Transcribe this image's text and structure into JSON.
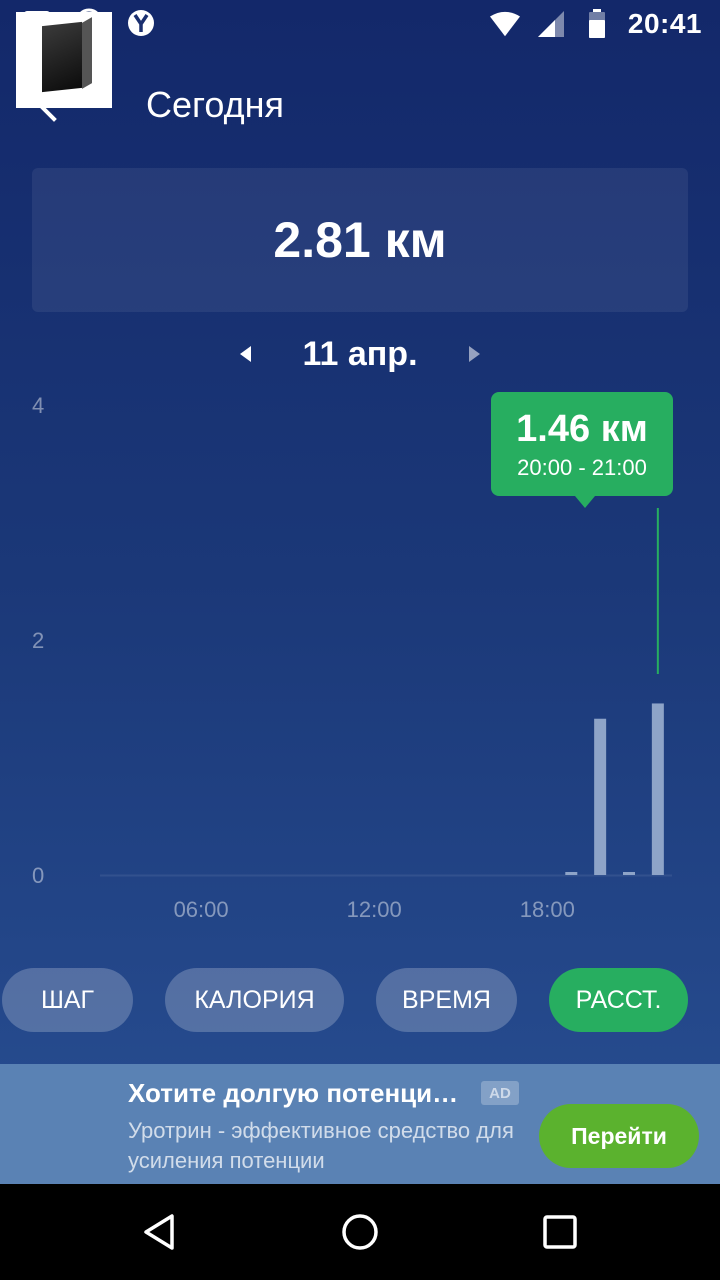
{
  "status_bar": {
    "time": "20:41",
    "left_icons": [
      "message-icon",
      "whatsapp-icon",
      "yandex-icon"
    ],
    "right_icons": [
      "wifi-icon",
      "signal-icon",
      "battery-icon"
    ]
  },
  "header": {
    "title": "Сегодня",
    "back_icon": "arrow-left-icon"
  },
  "summary": {
    "total": "2.81 км"
  },
  "date_nav": {
    "date": "11 апр.",
    "prev_icon": "triangle-left-icon",
    "next_icon": "triangle-right-icon"
  },
  "chart_data": {
    "type": "bar",
    "x_unit": "hour",
    "x_ticks": [
      "06:00",
      "12:00",
      "18:00"
    ],
    "y_ticks": [
      "0",
      "2",
      "4"
    ],
    "ylim": [
      0,
      4
    ],
    "xlim": [
      0,
      24
    ],
    "bars": [
      {
        "hour": 18,
        "value": 0.02
      },
      {
        "hour": 19,
        "value": 1.33
      },
      {
        "hour": 20,
        "value": 0.02
      },
      {
        "hour": 21,
        "value": 1.46
      }
    ],
    "tooltip": {
      "value": "1.46 км",
      "range": "20:00 - 21:00"
    }
  },
  "tabs": [
    {
      "label": "ШАГ",
      "active": false
    },
    {
      "label": "КАЛОРИЯ",
      "active": false
    },
    {
      "label": "ВРЕМЯ",
      "active": false
    },
    {
      "label": "РАССТ.",
      "active": true
    }
  ],
  "ad": {
    "title": "Хотите долгую потенци…",
    "badge": "AD",
    "description": "Уротрин - эффективное средство для усиления потенции",
    "button": "Перейти"
  },
  "colors": {
    "accent": "#27ae60",
    "ad_button": "#5bb22e",
    "bar": "#8ea4c8"
  },
  "nav": {
    "back": "back-triangle-icon",
    "home": "home-circle-icon",
    "recents": "recents-square-icon"
  }
}
